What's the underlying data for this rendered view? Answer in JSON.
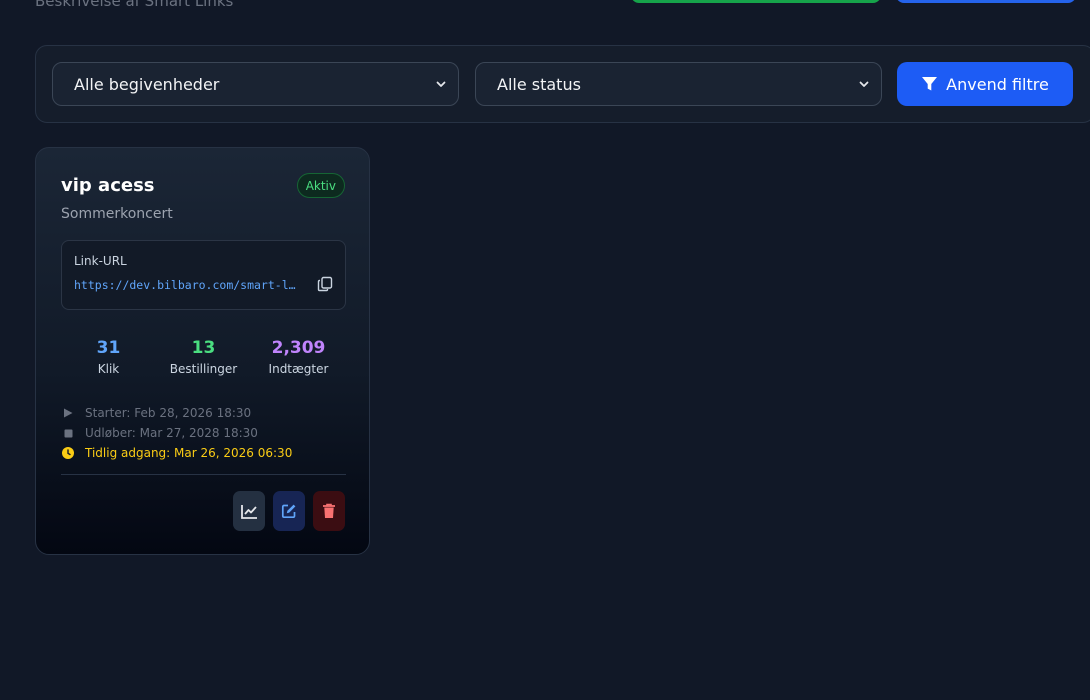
{
  "header": {
    "subtitle": "Beskrivelse af Smart Links"
  },
  "filters": {
    "event_select": {
      "selected": "Alle begivenheder"
    },
    "status_select": {
      "selected": "Alle status"
    },
    "apply_label": "Anvend filtre"
  },
  "cards": [
    {
      "title": "vip acess",
      "status": "Aktiv",
      "event": "Sommerkoncert",
      "url_label": "Link-URL",
      "url": "https://dev.bilbaro.com/smart-l…",
      "stats": [
        {
          "value": "31",
          "label": "Klik"
        },
        {
          "value": "13",
          "label": "Bestillinger"
        },
        {
          "value": "2,309",
          "label": "Indtægter"
        }
      ],
      "starts": "Starter: Feb 28, 2026 18:30",
      "expires": "Udløber: Mar 27, 2028 18:30",
      "early_access": "Tidlig adgang: Mar 26, 2026 06:30"
    }
  ],
  "colors": {
    "accent_blue": "#1d5cf5",
    "active_green": "#4ade80",
    "early_yellow": "#facc15",
    "delete_red": "#f87171"
  },
  "icons": {
    "apply": "filter-icon",
    "copy": "copy-icon",
    "start": "play-icon",
    "expire": "stop-icon",
    "early": "clock-icon",
    "stats_action": "chart-line-icon",
    "edit_action": "edit-icon",
    "delete_action": "trash-icon"
  }
}
